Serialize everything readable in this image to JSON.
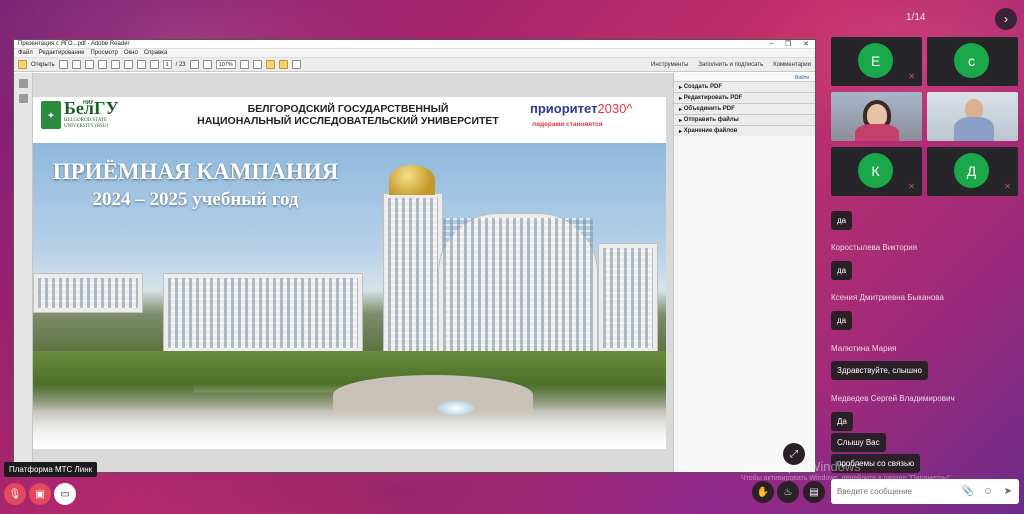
{
  "meeting": {
    "page_counter": "1/14",
    "next_glyph": "›",
    "platform_tooltip": "Платформа МТС Линк",
    "expand_glyph": "⤢"
  },
  "acrobat": {
    "window_title": "Презентация с ЯГО...pdf - Adobe Reader",
    "menu": [
      "Файл",
      "Редактирование",
      "Просмотр",
      "Окно",
      "Справка"
    ],
    "open_label": "Открыть",
    "page_current": "1",
    "page_total": "/ 23",
    "zoom": "107%",
    "right_tools": [
      "Инструменты",
      "Заполнить и подписать",
      "Комментарии"
    ],
    "signin": "Войти",
    "panels": [
      "Создать PDF",
      "Редактировать PDF",
      "Объединить PDF",
      "Отправить файлы",
      "Хранение файлов"
    ]
  },
  "slide": {
    "logo_nii": "НИУ",
    "logo_name": "БелГУ",
    "logo_sub1": "BELGOROD STATE",
    "logo_sub2": "UNIVERSITY (BSU)",
    "univ_line1": "БЕЛГОРОДСКИЙ ГОСУДАРСТВЕННЫЙ",
    "univ_line2": "НАЦИОНАЛЬНЫЙ ИССЛЕДОВАТЕЛЬСКИЙ УНИВЕРСИТЕТ",
    "prio_word": "приоритет",
    "prio_num": "2030",
    "prio_mark": "^",
    "prio_sub": "лидерами становятся",
    "title1": "ПРИЁМНАЯ КАМПАНИЯ",
    "title2": "2024 – 2025 учебный год"
  },
  "participants": [
    {
      "initial": "Е",
      "muted": true
    },
    {
      "initial": "с",
      "muted": false
    },
    {
      "initial": "К",
      "muted": true
    },
    {
      "initial": "Д",
      "muted": true
    }
  ],
  "chat": {
    "messages": [
      {
        "author": "",
        "text": "да"
      },
      {
        "author": "Коростылева Виктория",
        "text": "да"
      },
      {
        "author": "Ксения Дмитриевна Быканова",
        "text": "да"
      },
      {
        "author": "Малютина Мария",
        "text": "Здравствуйте, слышно"
      },
      {
        "author": "Медведев Сергей Владимирович",
        "text": "Да"
      },
      {
        "author": "",
        "text": "Слышу Вас"
      },
      {
        "author": "",
        "text": "проблемы со связью"
      }
    ],
    "input_placeholder": "Введите сообщение"
  },
  "windows_activation": {
    "line1": "Активация Windows",
    "line2": "Чтобы активировать Windows, перейдите в раздел \"Параметры\"."
  },
  "icons": {
    "mic_off": "🎙",
    "cam_off": "▣",
    "screen": "▭",
    "hand": "✋",
    "reaction": "♨",
    "layout": "▤",
    "attach": "📎",
    "emoji": "☺",
    "send": "➤",
    "mute": "✕"
  },
  "colors": {
    "accent_green": "#1aa84a",
    "mute_red": "#e24a5e",
    "chat_bubble": "#2b2028"
  }
}
